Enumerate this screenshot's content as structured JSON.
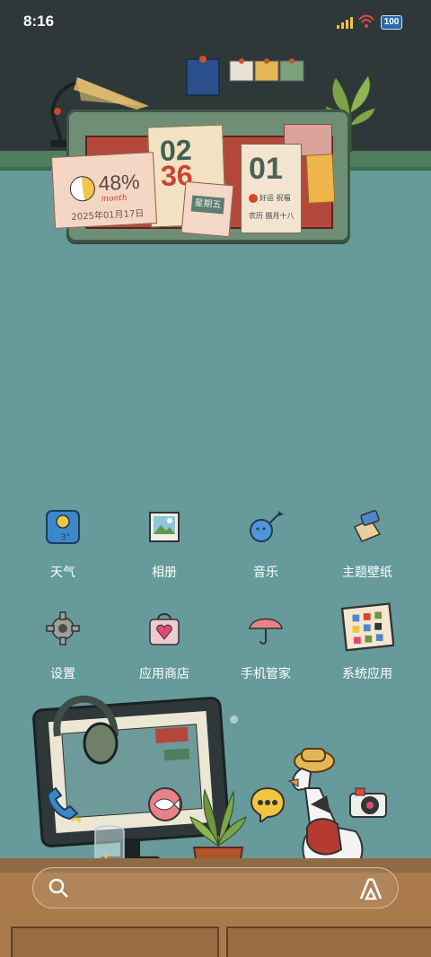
{
  "status_bar": {
    "time": "8:16",
    "battery": "100",
    "signal_color": "#f0c540"
  },
  "widget": {
    "percent": "48%",
    "percent_value": 0.48,
    "month_label": "month",
    "date": "2025年01月17日",
    "hour": "02",
    "minute": "36",
    "weekday": "星期五",
    "day": "01",
    "luck": "好运 祝福",
    "lunar": "农历 腊月十八"
  },
  "apps": [
    {
      "label": "天气",
      "icon": "weather-icon"
    },
    {
      "label": "相册",
      "icon": "gallery-icon"
    },
    {
      "label": "音乐",
      "icon": "music-icon"
    },
    {
      "label": "主题壁纸",
      "icon": "theme-icon"
    },
    {
      "label": "设置",
      "icon": "settings-gear-icon"
    },
    {
      "label": "应用商店",
      "icon": "app-store-bag-icon"
    },
    {
      "label": "手机管家",
      "icon": "phone-manager-umbrella-icon"
    },
    {
      "label": "系统应用",
      "icon": "system-apps-folder-icon"
    }
  ],
  "weather_icon_text": "3°",
  "page_indicator": {
    "pages": 2,
    "current": 1
  },
  "dock": [
    {
      "icon": "phone-icon"
    },
    {
      "icon": "messages-fish-icon"
    },
    {
      "icon": "chat-bubble-icon"
    },
    {
      "icon": "camera-icon"
    }
  ],
  "search_bar": {
    "left_icon": "search-icon",
    "right_icon": "ai-assistant-icon"
  },
  "colors": {
    "background": "#679a9a",
    "wall_dark": "#2f3838",
    "desk": "#ab7a4b"
  }
}
